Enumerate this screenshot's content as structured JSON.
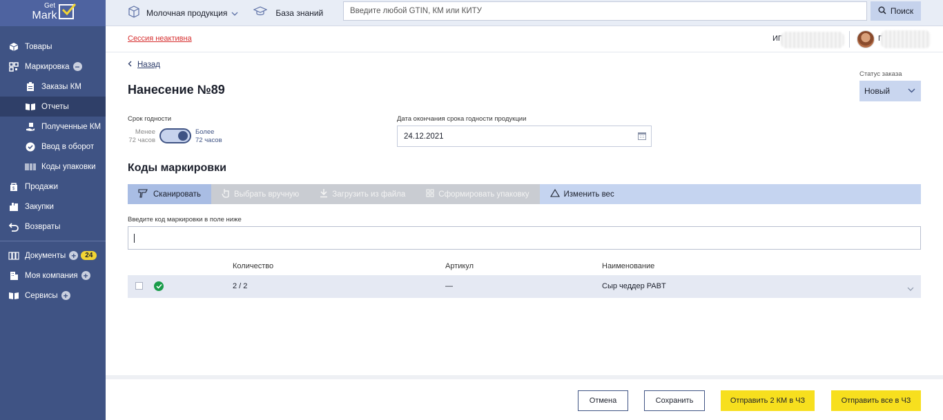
{
  "logo": {
    "get": "Get",
    "mark": "Mark"
  },
  "sidebar": {
    "items": [
      {
        "label": "Товары",
        "icon": "box-icon"
      },
      {
        "label": "Маркировка",
        "icon": "qr-icon"
      },
      {
        "label": "Заказы КМ",
        "icon": "orders-icon"
      },
      {
        "label": "Отчеты",
        "icon": "book-icon"
      },
      {
        "label": "Полученные КМ",
        "icon": "hand-icon"
      },
      {
        "label": "Ввод в оборот",
        "icon": "check-circle-icon"
      },
      {
        "label": "Коды упаковки",
        "icon": "barcode-icon"
      },
      {
        "label": "Продажи",
        "icon": "cart-icon"
      },
      {
        "label": "Закупки",
        "icon": "bag-icon"
      },
      {
        "label": "Возвраты",
        "icon": "return-icon"
      },
      {
        "label": "Документы",
        "icon": "documents-icon",
        "count": "24"
      },
      {
        "label": "Моя компания",
        "icon": "building-icon"
      },
      {
        "label": "Сервисы",
        "icon": "services-icon"
      }
    ]
  },
  "topbar": {
    "category": "Молочная продукция",
    "knowledge_base": "База знаний",
    "search_placeholder": "Введите любой GTIN, КМ или КИТУ",
    "search_button": "Поиск"
  },
  "subheader": {
    "session": "Сессия неактивна",
    "org_prefix": "ИГ",
    "user_initial": "Г"
  },
  "page": {
    "back": "Назад",
    "title": "Нанесение №89",
    "status_label": "Статус заказа",
    "status_value": "Новый",
    "shelf_label": "Срок годности",
    "toggle_less_1": "Менее",
    "toggle_less_2": "72 часов",
    "toggle_more_1": "Более",
    "toggle_more_2": "72 часов",
    "toggle_on": true,
    "date_label": "Дата окончания срока годности продукции",
    "date_value": "24.12.2021",
    "section": "Коды маркировки",
    "tabs": [
      "Сканировать",
      "Выбрать вручную",
      "Загрузить из файла",
      "Сформировать упаковку",
      "Изменить вес"
    ],
    "code_label": "Введите код маркировки в поле ниже",
    "table": {
      "headers": [
        "Количество",
        "Артикул",
        "Наименование"
      ],
      "rows": [
        {
          "quantity": "2 / 2",
          "article": "—",
          "name": "Сыр чеддер PABT"
        }
      ]
    }
  },
  "footer": {
    "cancel": "Отмена",
    "save": "Сохранить",
    "send_km": "Отправить 2 КМ в ЧЗ",
    "send_all": "Отправить все в ЧЗ"
  },
  "colors": {
    "sidebar": "#3f5384",
    "accent_yellow": "#f7df1e",
    "error": "#d62d2d",
    "success": "#1a9c4a"
  }
}
